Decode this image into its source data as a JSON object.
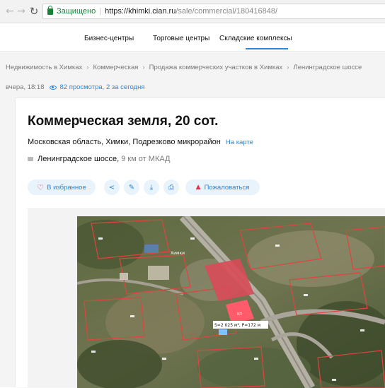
{
  "browser": {
    "secure_label": "Защищено",
    "url_host": "https://khimki.cian.ru",
    "url_path": "/sale/commercial/180416848/"
  },
  "site_nav": {
    "items": [
      "Бизнес-центры",
      "Торговые центры",
      "Складские комплексы"
    ],
    "active_index": 2
  },
  "breadcrumb": [
    "Недвижимость в Химках",
    "Коммерческая",
    "Продажа коммерческих участков в Химках",
    "Ленинградское шоссе"
  ],
  "meta": {
    "updated": "вчера, 18:18",
    "views": "82 просмотра, 2 за сегодня"
  },
  "listing": {
    "title": "Коммерческая земля, 20 сот.",
    "address": "Московская область, Химки, Подрезково микрорайон",
    "map_link": "На карте",
    "highway": "Ленинградское шоссе,",
    "highway_distance": "9 км от МКАД"
  },
  "actions": {
    "favorite": "В избранное",
    "share_icon": "share-icon",
    "edit_icon": "pencil-icon",
    "download_icon": "download-icon",
    "print_icon": "print-icon",
    "complain": "Пожаловаться"
  },
  "map": {
    "labels": [
      "S=2 025 м², P=172 м",
      "БП",
      "Химки"
    ]
  },
  "colors": {
    "accent": "#2b87db",
    "danger": "#e1324b",
    "secure": "#188038"
  }
}
